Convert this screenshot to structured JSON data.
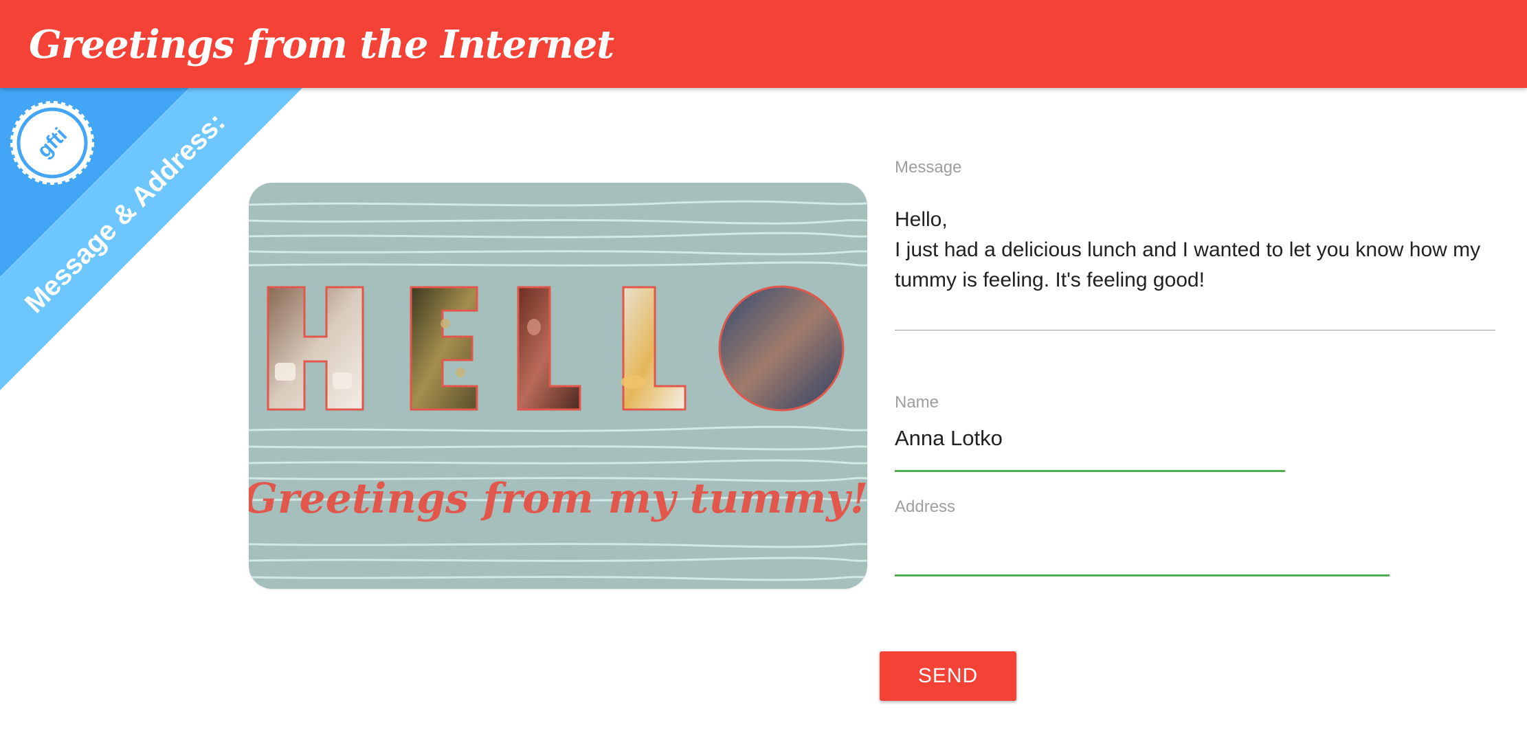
{
  "app": {
    "title": "Greetings from the Internet"
  },
  "step_banner": {
    "label": "Message & Address:",
    "badge_text": "gfti"
  },
  "card": {
    "headline_letters": [
      "H",
      "E",
      "L",
      "L",
      "O"
    ],
    "tagline": "Greetings from my tummy!"
  },
  "form": {
    "message": {
      "label": "Message",
      "value": "Hello,\nI just had a delicious lunch and I wanted to let you know how my tummy is feeling. It's feeling good!"
    },
    "name": {
      "label": "Name",
      "value": "Anna Lotko"
    },
    "address": {
      "label": "Address",
      "value": ""
    }
  },
  "actions": {
    "send_label": "SEND"
  },
  "colors": {
    "brand_red": "#f44336",
    "banner_blue": "#42a5f5",
    "banner_light_blue": "#6ec6ff",
    "card_background": "#a5bfbd",
    "valid_green": "#4caf50"
  }
}
